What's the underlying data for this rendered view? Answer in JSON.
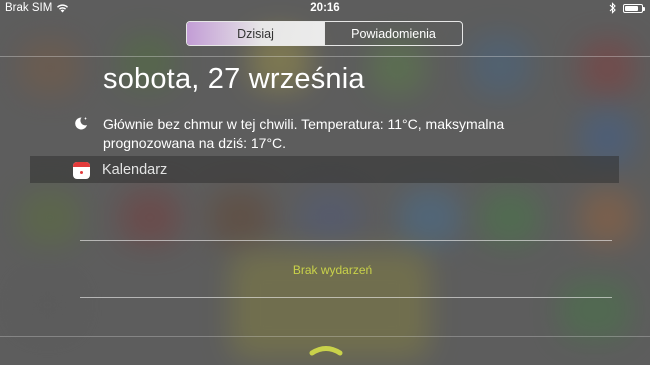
{
  "status_bar": {
    "carrier": "Brak SIM",
    "time": "20:16",
    "battery_level": 0.8
  },
  "tabs": [
    {
      "label": "Dzisiaj",
      "active": true
    },
    {
      "label": "Powiadomienia",
      "active": false
    }
  ],
  "today": {
    "date": "sobota, 27 września",
    "weather_icon": "moon-star-icon",
    "weather_text": "Głównie bez chmur w tej chwili. Temperatura: 11°C, maksymalna prognozowana na dziś: 17°C."
  },
  "calendar": {
    "icon": "calendar-icon",
    "label": "Kalendarz",
    "empty_text": "Brak wydarzeń"
  },
  "colors": {
    "accent_yellow": "#c9d24a",
    "calendar_red": "#e23b3b"
  }
}
